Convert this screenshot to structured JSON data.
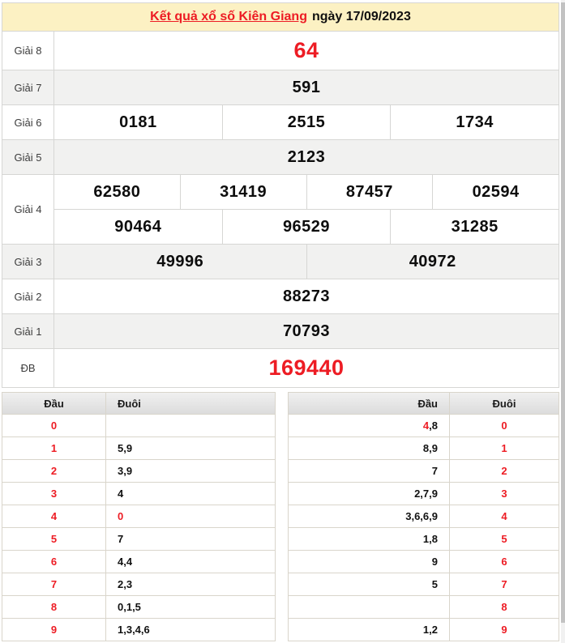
{
  "title": {
    "link": "Kết quả xổ số Kiên Giang",
    "date": "ngày 17/09/2023"
  },
  "prizes": {
    "rows": [
      {
        "label": "Giải 8",
        "large": true,
        "groups": [
          [
            "64"
          ]
        ]
      },
      {
        "label": "Giải 7",
        "large": false,
        "groups": [
          [
            "591"
          ]
        ]
      },
      {
        "label": "Giải 6",
        "large": false,
        "groups": [
          [
            "0181",
            "2515",
            "1734"
          ]
        ]
      },
      {
        "label": "Giải 5",
        "large": false,
        "groups": [
          [
            "2123"
          ]
        ]
      },
      {
        "label": "Giải 4",
        "large": false,
        "groups": [
          [
            "62580",
            "31419",
            "87457",
            "02594"
          ],
          [
            "90464",
            "96529",
            "31285"
          ]
        ]
      },
      {
        "label": "Giải 3",
        "large": false,
        "groups": [
          [
            "49996",
            "40972"
          ]
        ]
      },
      {
        "label": "Giải 2",
        "large": false,
        "groups": [
          [
            "88273"
          ]
        ]
      },
      {
        "label": "Giải 1",
        "large": false,
        "groups": [
          [
            "70793"
          ]
        ]
      },
      {
        "label": "ĐB",
        "large": true,
        "groups": [
          [
            "169440"
          ]
        ]
      }
    ]
  },
  "head_tail": {
    "left": {
      "head_header": "Đầu",
      "tail_header": "Đuôi",
      "rows": [
        {
          "head": "0",
          "tail": "",
          "tail_red": false
        },
        {
          "head": "1",
          "tail": "5,9",
          "tail_red": false
        },
        {
          "head": "2",
          "tail": "3,9",
          "tail_red": false
        },
        {
          "head": "3",
          "tail": "4",
          "tail_red": false
        },
        {
          "head": "4",
          "tail": "0",
          "tail_red": true
        },
        {
          "head": "5",
          "tail": "7",
          "tail_red": false
        },
        {
          "head": "6",
          "tail": "4,4",
          "tail_red": false
        },
        {
          "head": "7",
          "tail": "2,3",
          "tail_red": false
        },
        {
          "head": "8",
          "tail": "0,1,5",
          "tail_red": false
        },
        {
          "head": "9",
          "tail": "1,3,4,6",
          "tail_red": false
        }
      ]
    },
    "right": {
      "head_header": "Đầu",
      "tail_header": "Đuôi",
      "rows": [
        {
          "head_red": "4",
          "head": ",8",
          "tail": "0"
        },
        {
          "head_red": "",
          "head": "8,9",
          "tail": "1"
        },
        {
          "head_red": "",
          "head": "7",
          "tail": "2"
        },
        {
          "head_red": "",
          "head": "2,7,9",
          "tail": "3"
        },
        {
          "head_red": "",
          "head": "3,6,6,9",
          "tail": "4"
        },
        {
          "head_red": "",
          "head": "1,8",
          "tail": "5"
        },
        {
          "head_red": "",
          "head": "9",
          "tail": "6"
        },
        {
          "head_red": "",
          "head": "5",
          "tail": "7"
        },
        {
          "head_red": "",
          "head": "",
          "tail": "8"
        },
        {
          "head_red": "",
          "head": "1,2",
          "tail": "9"
        }
      ]
    }
  },
  "colors": {
    "accent_red": "#ed1c24",
    "header_yellow": "#fcf1c3",
    "zebra_gray": "#f1f1f0",
    "border_gray": "#d6d6d4",
    "border_tan": "#d9d5cb"
  }
}
